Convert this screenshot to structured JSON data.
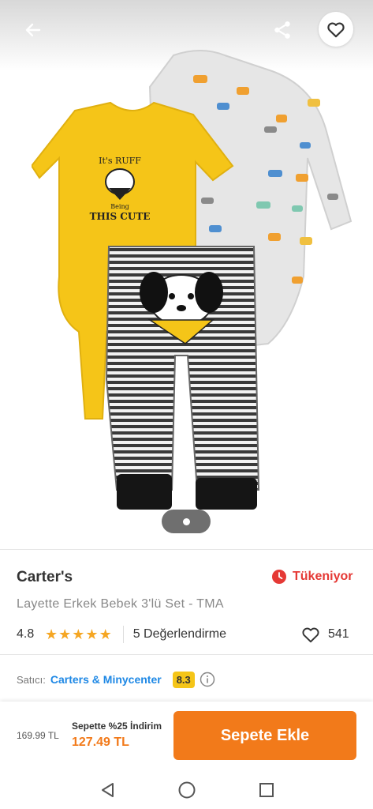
{
  "product": {
    "brand": "Carter's",
    "stock_status": "Tükeniyor",
    "title": "Layette Erkek Bebek 3'lü Set - TMA",
    "rating": "4.8",
    "stars_filled": 5,
    "reviews_label": "5 Değerlendirme",
    "favorite_count": "541",
    "print_line1": "It's RUFF",
    "print_line2": "Being",
    "print_line3": "THIS CUTE"
  },
  "seller": {
    "label": "Satıcı:",
    "name": "Carters & Minycenter",
    "score": "8.3"
  },
  "purchase": {
    "old_price": "169.99 TL",
    "promo": "Sepette %25 İndirim",
    "new_price": "127.49 TL",
    "add_to_cart_label": "Sepete Ekle"
  },
  "colors": {
    "accent": "#f27a1a",
    "stock_red": "#e53935",
    "seller_blue": "#1e88e5",
    "star": "#f5a623"
  },
  "icons": {
    "back": "arrow-left-icon",
    "share": "share-icon",
    "favorite": "heart-icon",
    "stock": "clock-icon",
    "info": "info-icon"
  }
}
